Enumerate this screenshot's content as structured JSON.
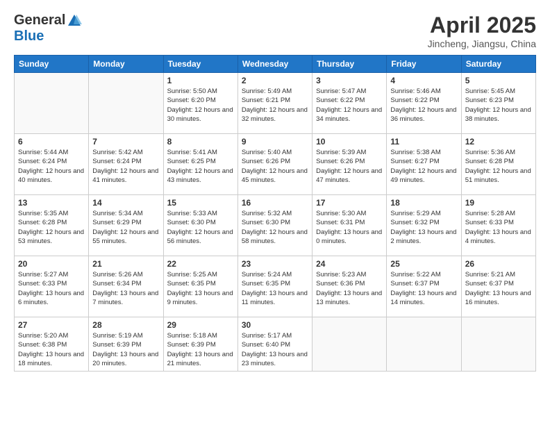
{
  "logo": {
    "general": "General",
    "blue": "Blue"
  },
  "title": "April 2025",
  "subtitle": "Jincheng, Jiangsu, China",
  "headers": [
    "Sunday",
    "Monday",
    "Tuesday",
    "Wednesday",
    "Thursday",
    "Friday",
    "Saturday"
  ],
  "weeks": [
    [
      {
        "day": "",
        "sunrise": "",
        "sunset": "",
        "daylight": ""
      },
      {
        "day": "",
        "sunrise": "",
        "sunset": "",
        "daylight": ""
      },
      {
        "day": "1",
        "sunrise": "Sunrise: 5:50 AM",
        "sunset": "Sunset: 6:20 PM",
        "daylight": "Daylight: 12 hours and 30 minutes."
      },
      {
        "day": "2",
        "sunrise": "Sunrise: 5:49 AM",
        "sunset": "Sunset: 6:21 PM",
        "daylight": "Daylight: 12 hours and 32 minutes."
      },
      {
        "day": "3",
        "sunrise": "Sunrise: 5:47 AM",
        "sunset": "Sunset: 6:22 PM",
        "daylight": "Daylight: 12 hours and 34 minutes."
      },
      {
        "day": "4",
        "sunrise": "Sunrise: 5:46 AM",
        "sunset": "Sunset: 6:22 PM",
        "daylight": "Daylight: 12 hours and 36 minutes."
      },
      {
        "day": "5",
        "sunrise": "Sunrise: 5:45 AM",
        "sunset": "Sunset: 6:23 PM",
        "daylight": "Daylight: 12 hours and 38 minutes."
      }
    ],
    [
      {
        "day": "6",
        "sunrise": "Sunrise: 5:44 AM",
        "sunset": "Sunset: 6:24 PM",
        "daylight": "Daylight: 12 hours and 40 minutes."
      },
      {
        "day": "7",
        "sunrise": "Sunrise: 5:42 AM",
        "sunset": "Sunset: 6:24 PM",
        "daylight": "Daylight: 12 hours and 41 minutes."
      },
      {
        "day": "8",
        "sunrise": "Sunrise: 5:41 AM",
        "sunset": "Sunset: 6:25 PM",
        "daylight": "Daylight: 12 hours and 43 minutes."
      },
      {
        "day": "9",
        "sunrise": "Sunrise: 5:40 AM",
        "sunset": "Sunset: 6:26 PM",
        "daylight": "Daylight: 12 hours and 45 minutes."
      },
      {
        "day": "10",
        "sunrise": "Sunrise: 5:39 AM",
        "sunset": "Sunset: 6:26 PM",
        "daylight": "Daylight: 12 hours and 47 minutes."
      },
      {
        "day": "11",
        "sunrise": "Sunrise: 5:38 AM",
        "sunset": "Sunset: 6:27 PM",
        "daylight": "Daylight: 12 hours and 49 minutes."
      },
      {
        "day": "12",
        "sunrise": "Sunrise: 5:36 AM",
        "sunset": "Sunset: 6:28 PM",
        "daylight": "Daylight: 12 hours and 51 minutes."
      }
    ],
    [
      {
        "day": "13",
        "sunrise": "Sunrise: 5:35 AM",
        "sunset": "Sunset: 6:28 PM",
        "daylight": "Daylight: 12 hours and 53 minutes."
      },
      {
        "day": "14",
        "sunrise": "Sunrise: 5:34 AM",
        "sunset": "Sunset: 6:29 PM",
        "daylight": "Daylight: 12 hours and 55 minutes."
      },
      {
        "day": "15",
        "sunrise": "Sunrise: 5:33 AM",
        "sunset": "Sunset: 6:30 PM",
        "daylight": "Daylight: 12 hours and 56 minutes."
      },
      {
        "day": "16",
        "sunrise": "Sunrise: 5:32 AM",
        "sunset": "Sunset: 6:30 PM",
        "daylight": "Daylight: 12 hours and 58 minutes."
      },
      {
        "day": "17",
        "sunrise": "Sunrise: 5:30 AM",
        "sunset": "Sunset: 6:31 PM",
        "daylight": "Daylight: 13 hours and 0 minutes."
      },
      {
        "day": "18",
        "sunrise": "Sunrise: 5:29 AM",
        "sunset": "Sunset: 6:32 PM",
        "daylight": "Daylight: 13 hours and 2 minutes."
      },
      {
        "day": "19",
        "sunrise": "Sunrise: 5:28 AM",
        "sunset": "Sunset: 6:33 PM",
        "daylight": "Daylight: 13 hours and 4 minutes."
      }
    ],
    [
      {
        "day": "20",
        "sunrise": "Sunrise: 5:27 AM",
        "sunset": "Sunset: 6:33 PM",
        "daylight": "Daylight: 13 hours and 6 minutes."
      },
      {
        "day": "21",
        "sunrise": "Sunrise: 5:26 AM",
        "sunset": "Sunset: 6:34 PM",
        "daylight": "Daylight: 13 hours and 7 minutes."
      },
      {
        "day": "22",
        "sunrise": "Sunrise: 5:25 AM",
        "sunset": "Sunset: 6:35 PM",
        "daylight": "Daylight: 13 hours and 9 minutes."
      },
      {
        "day": "23",
        "sunrise": "Sunrise: 5:24 AM",
        "sunset": "Sunset: 6:35 PM",
        "daylight": "Daylight: 13 hours and 11 minutes."
      },
      {
        "day": "24",
        "sunrise": "Sunrise: 5:23 AM",
        "sunset": "Sunset: 6:36 PM",
        "daylight": "Daylight: 13 hours and 13 minutes."
      },
      {
        "day": "25",
        "sunrise": "Sunrise: 5:22 AM",
        "sunset": "Sunset: 6:37 PM",
        "daylight": "Daylight: 13 hours and 14 minutes."
      },
      {
        "day": "26",
        "sunrise": "Sunrise: 5:21 AM",
        "sunset": "Sunset: 6:37 PM",
        "daylight": "Daylight: 13 hours and 16 minutes."
      }
    ],
    [
      {
        "day": "27",
        "sunrise": "Sunrise: 5:20 AM",
        "sunset": "Sunset: 6:38 PM",
        "daylight": "Daylight: 13 hours and 18 minutes."
      },
      {
        "day": "28",
        "sunrise": "Sunrise: 5:19 AM",
        "sunset": "Sunset: 6:39 PM",
        "daylight": "Daylight: 13 hours and 20 minutes."
      },
      {
        "day": "29",
        "sunrise": "Sunrise: 5:18 AM",
        "sunset": "Sunset: 6:39 PM",
        "daylight": "Daylight: 13 hours and 21 minutes."
      },
      {
        "day": "30",
        "sunrise": "Sunrise: 5:17 AM",
        "sunset": "Sunset: 6:40 PM",
        "daylight": "Daylight: 13 hours and 23 minutes."
      },
      {
        "day": "",
        "sunrise": "",
        "sunset": "",
        "daylight": ""
      },
      {
        "day": "",
        "sunrise": "",
        "sunset": "",
        "daylight": ""
      },
      {
        "day": "",
        "sunrise": "",
        "sunset": "",
        "daylight": ""
      }
    ]
  ]
}
